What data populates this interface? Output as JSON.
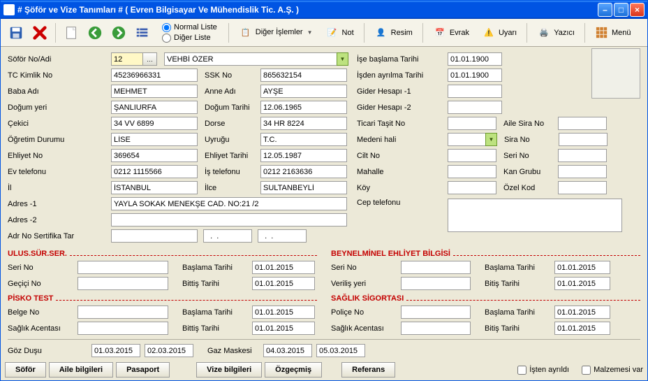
{
  "window": {
    "title": "# Şöför ve Vize Tanımları #   ( Evren Bilgisayar Ve Mühendislik Tic. A.Ş. )"
  },
  "toolbar": {
    "normal_liste": "Normal Liste",
    "diger_liste": "Diğer Liste",
    "diger_islemler": "Diğer İşlemler",
    "not": "Not",
    "resim": "Resim",
    "evrak": "Evrak",
    "uyari": "Uyarı",
    "yazici": "Yazıcı",
    "menu": "Menü"
  },
  "left": {
    "sofor_no_adi_lbl": "Söför No/Adi",
    "sofor_no": "12",
    "sofor_adi": "VEHBİ ÖZER",
    "tc_kimlik_lbl": "TC Kimlik No",
    "tc_kimlik": "45236966331",
    "ssk_lbl": "SSK No",
    "ssk": "865632154",
    "baba_lbl": "Baba Adı",
    "baba": "MEHMET",
    "anne_lbl": "Anne Adı",
    "anne": "AYŞE",
    "dogum_yeri_lbl": "Doğum yeri",
    "dogum_yeri": "ŞANLIURFA",
    "dogum_tarihi_lbl": "Doğum Tarihi",
    "dogum_tarihi": "12.06.1965",
    "cekici_lbl": "Çekici",
    "cekici": "34 VV 6899",
    "dorse_lbl": "Dorse",
    "dorse": "34 HR 8224",
    "ogretim_lbl": "Öğretim Durumu",
    "ogretim": "LİSE",
    "uyrugu_lbl": "Uyruğu",
    "uyrugu": "T.C.",
    "ehliyet_no_lbl": "Ehliyet No",
    "ehliyet_no": "369654",
    "ehliyet_tarihi_lbl": "Ehliyet Tarihi",
    "ehliyet_tarihi": "12.05.1987",
    "ev_tel_lbl": "Ev telefonu",
    "ev_tel": "0212 1115566",
    "is_tel_lbl": "İş telefonu",
    "is_tel": "0212 2163636",
    "il_lbl": "İl",
    "il": "İSTANBUL",
    "ilce_lbl": "İlce",
    "ilce": "SULTANBEYLİ",
    "adres1_lbl": "Adres -1",
    "adres1": "YAYLA SOKAK MENEKŞE CAD. NO:21 /2",
    "adres2_lbl": "Adres -2",
    "adres2": "",
    "adr_no_lbl": "Adr No Sertifika Tar",
    "adr_no": "",
    "adr_d1": "  .  .    ",
    "adr_d2": "  .  .    "
  },
  "right": {
    "ise_baslama_lbl": "İşe başlama Tarihi",
    "ise_baslama": "01.01.1900",
    "isden_ayrilma_lbl": "İşden ayrılma  Tarihi",
    "isden_ayrilma": "01.01.1900",
    "gider1_lbl": "Gider Hesapı -1",
    "gider1": "",
    "gider2_lbl": "Gider Hesapı -2",
    "gider2": "",
    "ticari_lbl": "Ticari Taşit No",
    "ticari": "",
    "aile_sira_lbl": "Aile Sira No",
    "aile_sira": "",
    "medeni_lbl": "Medeni hali",
    "medeni": "",
    "sira_no_lbl": "Sira No",
    "sira_no": "",
    "cilt_lbl": "Cilt No",
    "cilt": "",
    "seri_no_lbl": "Seri No",
    "seri_no": "",
    "mahalle_lbl": "Mahalle",
    "mahalle": "",
    "kan_lbl": "Kan Grubu",
    "kan": "",
    "koy_lbl": "Köy",
    "koy": "",
    "ozel_kod_lbl": "Özel Kod",
    "ozel_kod": "",
    "cep_lbl": "Cep telefonu",
    "cep": ""
  },
  "ulus": {
    "title": "ULUS.SÜR.SER.",
    "seri_no_lbl": "Seri No",
    "seri_no": "",
    "baslama_lbl": "Başlama Tarihi",
    "baslama": "01.01.2015",
    "gecici_lbl": "Geçiçi No",
    "gecici": "",
    "bitis_lbl": "Bittiş Tarihi",
    "bitis": "01.01.2015"
  },
  "beynelminel": {
    "title": "BEYNELMİNEL EHLİYET BİLGİSİ",
    "seri_no_lbl": "Seri No",
    "seri_no": "",
    "baslama_lbl": "Başlama Tarihi",
    "baslama": "01.01.2015",
    "verilis_lbl": "Veriliş yeri",
    "verilis": "",
    "bitis_lbl": "Bitiş Tarihi",
    "bitis": "01.01.2015"
  },
  "pisko": {
    "title": "PİSKO TEST",
    "belge_lbl": "Belge No",
    "belge": "",
    "baslama_lbl": "Başlama Tarihi",
    "baslama": "01.01.2015",
    "saglik_lbl": "Sağlık Acentası",
    "saglik": "",
    "bitis_lbl": "Bittiş Tarihi",
    "bitis": "01.01.2015"
  },
  "saglik": {
    "title": "SAĞLIK SİGORTASI",
    "police_lbl": "Poliçe No",
    "police": "",
    "baslama_lbl": "Başlama Tarihi",
    "baslama": "01.01.2015",
    "acenta_lbl": "Sağlık Acentası",
    "acenta": "",
    "bitis_lbl": "Bitiş Tarihi",
    "bitis": "01.01.2015"
  },
  "bottom": {
    "goz_lbl": "Göz Duşu",
    "goz_d1": "01.03.2015",
    "goz_d2": "02.03.2015",
    "gaz_lbl": "Gaz Maskesi",
    "gaz_d1": "04.03.2015",
    "gaz_d2": "05.03.2015"
  },
  "tabs": {
    "sofor": "Söför",
    "aile": "Aile bilgileri",
    "pasaport": "Pasaport",
    "vize": "Vize bilgileri",
    "ozgecmis": "Özgeçmiş",
    "referans": "Referans"
  },
  "checks": {
    "isten": "İşten ayrıldı",
    "malzeme": "Malzemesi var"
  }
}
